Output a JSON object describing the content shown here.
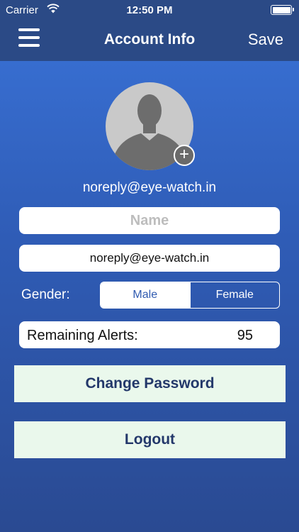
{
  "status_bar": {
    "carrier": "Carrier",
    "time": "12:50 PM",
    "wifi_icon": "wifi-icon",
    "battery_icon": "battery-icon"
  },
  "nav": {
    "menu_icon": "hamburger-menu-icon",
    "title": "Account Info",
    "save_label": "Save"
  },
  "profile": {
    "avatar_icon": "person-silhouette-icon",
    "add_photo_icon": "plus-circle-icon",
    "add_photo_glyph": "+",
    "email_display": "noreply@eye-watch.in"
  },
  "form": {
    "name_placeholder": "Name",
    "name_value": "",
    "email_value": "noreply@eye-watch.in",
    "gender_label": "Gender:",
    "gender_options": [
      "Male",
      "Female"
    ],
    "gender_selected": "Male",
    "alerts_label": "Remaining Alerts:",
    "alerts_value": "95"
  },
  "actions": {
    "change_password_label": "Change Password",
    "logout_label": "Logout"
  },
  "colors": {
    "nav_background": "#2b4a86",
    "gradient_top": "#3a73d8",
    "gradient_bottom": "#2a4a92",
    "button_background": "#eaf8ec",
    "button_text": "#23386a"
  }
}
